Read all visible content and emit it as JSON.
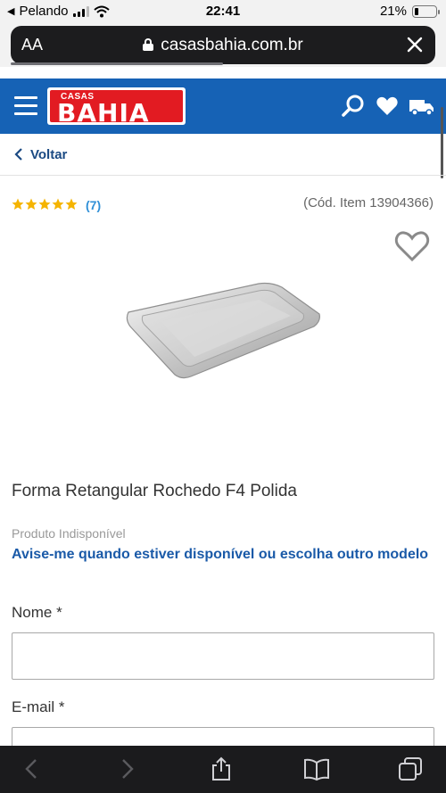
{
  "status_bar": {
    "carrier": "Pelando",
    "time": "22:41",
    "battery": "21%",
    "battery_level": 0.21
  },
  "browser": {
    "text_size_label": "AA",
    "url": "casasbahia.com.br",
    "load_progress": 0.5
  },
  "header": {
    "logo_top": "CASAS",
    "logo_main": "BAHIA",
    "brand_blue": "#1662b5",
    "brand_red": "#e21b22"
  },
  "nav": {
    "back_label": "Voltar"
  },
  "product": {
    "rating_stars": 5,
    "review_count": "(7)",
    "item_code": "(Cód. Item 13904366)",
    "title": "Forma Retangular Rochedo F4 Polida",
    "availability": "Produto Indisponível",
    "notify_text": "Avise-me quando estiver disponível ou escolha outro modelo"
  },
  "form": {
    "name_label": "Nome *",
    "name_value": "",
    "email_label": "E-mail *",
    "email_value": ""
  },
  "icons": [
    "chevron-left-icon",
    "search-icon",
    "heart-icon",
    "truck-icon",
    "menu-icon",
    "share-icon",
    "bookmarks-icon",
    "tabs-icon",
    "close-icon",
    "lock-icon",
    "wifi-icon",
    "star-icon"
  ]
}
